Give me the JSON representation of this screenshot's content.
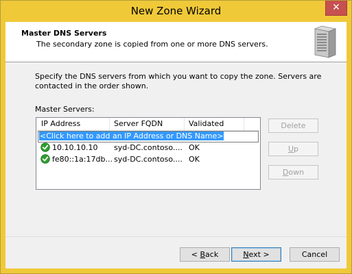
{
  "window": {
    "title": "New Zone Wizard",
    "close_glyph": "✕"
  },
  "header": {
    "title": "Master DNS Servers",
    "subtitle": "The secondary zone is copied from one or more DNS servers.",
    "icon": "server-icon"
  },
  "body": {
    "instructions_line1": "Specify the DNS servers from which you want to copy the zone.  Servers are",
    "instructions_line2": "contacted in the order shown.",
    "master_label": "Master Servers:"
  },
  "list": {
    "columns": [
      "IP Address",
      "Server FQDN",
      "Validated"
    ],
    "add_prompt": "<Click here to add an IP Address or DNS Name>",
    "rows": [
      {
        "ip": "10.10.10.10",
        "fqdn": "syd-DC.contoso....",
        "validated": "OK",
        "icon": "check-icon"
      },
      {
        "ip": "fe80::1a:17db...",
        "fqdn": "syd-DC.contoso....",
        "validated": "OK",
        "icon": "check-icon"
      }
    ]
  },
  "side_buttons": {
    "delete": {
      "text": "Delete",
      "enabled": false
    },
    "up": {
      "underlined": "U",
      "rest": "p",
      "enabled": false
    },
    "down": {
      "underlined": "D",
      "rest": "own",
      "enabled": false
    }
  },
  "footer": {
    "back": {
      "prefix": "< ",
      "underlined": "B",
      "rest": "ack"
    },
    "next": {
      "underlined": "N",
      "rest": "ext >"
    },
    "cancel": "Cancel"
  },
  "colors": {
    "title_bar": "#f0c939",
    "selection": "#3399ff",
    "close_button": "#c75050",
    "check": "#2f9e2f"
  }
}
